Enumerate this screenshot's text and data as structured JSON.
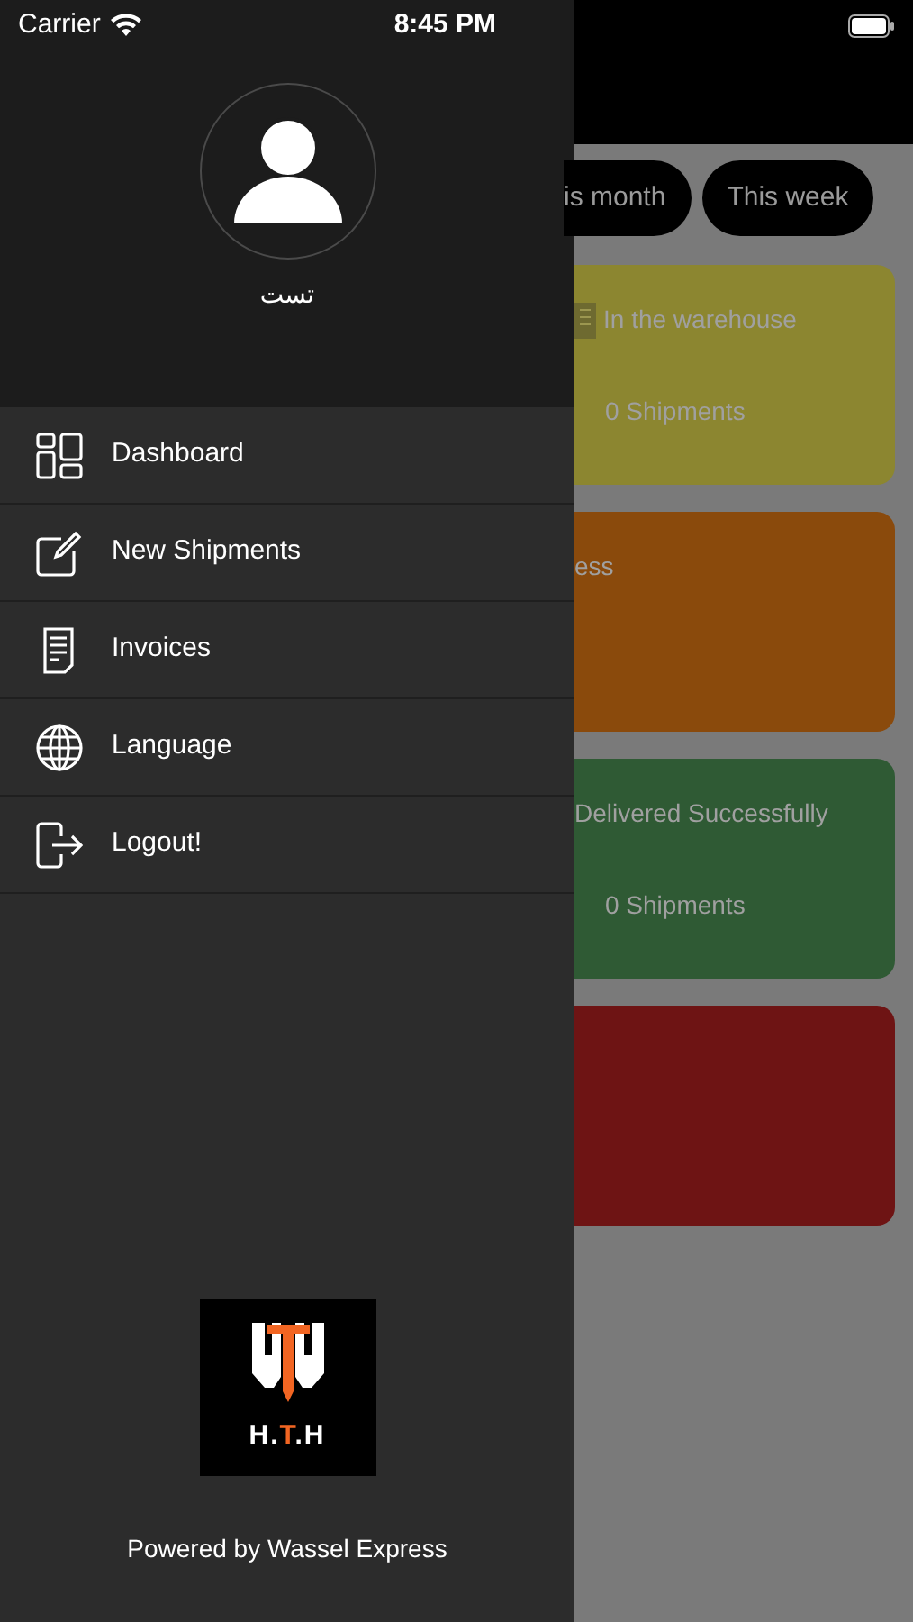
{
  "status_bar": {
    "carrier": "Carrier",
    "time": "8:45 PM"
  },
  "drawer": {
    "user_name": "تست",
    "menu": [
      {
        "label": "Dashboard",
        "kind": "dashboard"
      },
      {
        "label": "New Shipments",
        "kind": "edit"
      },
      {
        "label": "Invoices",
        "kind": "invoice"
      },
      {
        "label": "Language",
        "kind": "globe"
      },
      {
        "label": "Logout!",
        "kind": "logout"
      }
    ],
    "logo_text": [
      {
        "text": "H.",
        "accent": false
      },
      {
        "text": "T",
        "accent": true
      },
      {
        "text": ".H",
        "accent": false
      }
    ],
    "footer": "Powered by Wassel Express"
  },
  "background": {
    "filters": [
      {
        "label": "is month",
        "selected": false
      },
      {
        "label": "This week",
        "selected": false
      }
    ],
    "cards": [
      {
        "title": "In the warehouse",
        "count": "0 Shipments",
        "color": "#8c8630",
        "icon": true
      },
      {
        "title": "ess",
        "color": "#8a4a0c",
        "icon": false
      },
      {
        "title": "Delivered Successfully",
        "count": "0 Shipments",
        "color": "#2f5a34",
        "icon": false
      },
      {
        "color": "#6e1414"
      }
    ]
  }
}
